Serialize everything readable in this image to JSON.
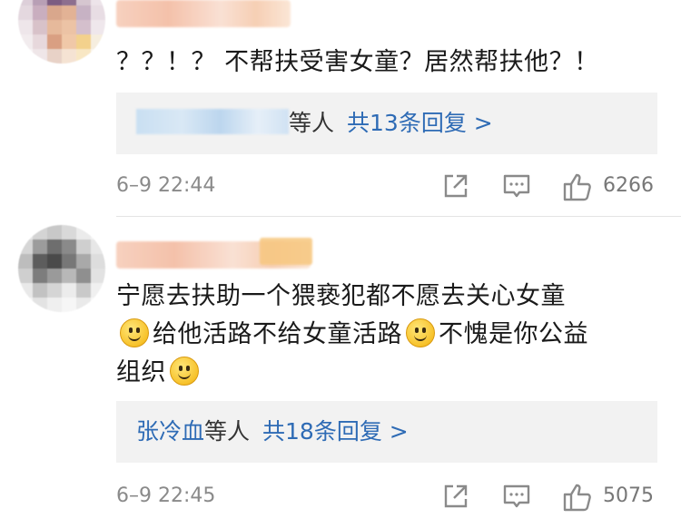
{
  "comments": [
    {
      "text": "？？！？ 不帮扶受害女童？居然帮扶他？！",
      "reply_name": "",
      "reply_mid": "等人",
      "reply_count": "共13条回复 >",
      "time": "6–9 22:44",
      "like_count": "6266"
    },
    {
      "text_line1": "宁愿去扶助一个猥亵犯都不愿去关心女童",
      "text_line2_a": "给他活路不给女童活路",
      "text_line2_b": "不愧是你公益",
      "text_line3": "组织",
      "reply_name": "张冷血",
      "reply_mid": "等人",
      "reply_count": "共18条回复 >",
      "time": "6–9 22:45",
      "like_count": "5075"
    }
  ],
  "icons": {
    "share": "share-icon",
    "comment": "comment-icon",
    "like": "thumbs-up-icon",
    "emoji": "smile-emoji-icon"
  },
  "colors": {
    "link": "#2e6bb5",
    "meta": "#8a8a8a",
    "reply_bg": "#f2f2f2"
  }
}
